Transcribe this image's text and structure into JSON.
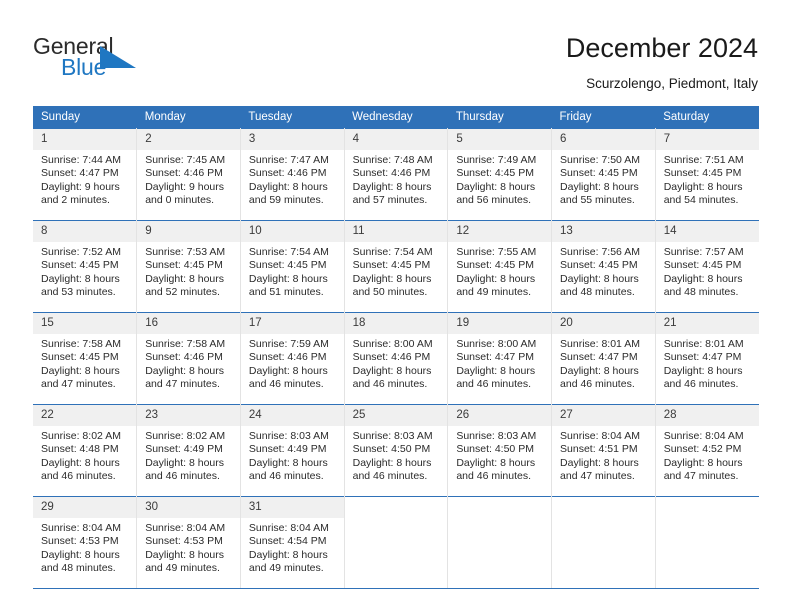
{
  "brand": {
    "name_top": "General",
    "name_bottom": "Blue",
    "accent_color": "#1f77c2"
  },
  "header": {
    "title": "December 2024",
    "subtitle": "Scurzolengo, Piedmont, Italy",
    "header_bg": "#2f71b8"
  },
  "calendar": {
    "weekdays": [
      "Sunday",
      "Monday",
      "Tuesday",
      "Wednesday",
      "Thursday",
      "Friday",
      "Saturday"
    ],
    "weeks": [
      [
        {
          "day": "1",
          "sunrise": "Sunrise: 7:44 AM",
          "sunset": "Sunset: 4:47 PM",
          "daylight_1": "Daylight: 9 hours",
          "daylight_2": "and 2 minutes."
        },
        {
          "day": "2",
          "sunrise": "Sunrise: 7:45 AM",
          "sunset": "Sunset: 4:46 PM",
          "daylight_1": "Daylight: 9 hours",
          "daylight_2": "and 0 minutes."
        },
        {
          "day": "3",
          "sunrise": "Sunrise: 7:47 AM",
          "sunset": "Sunset: 4:46 PM",
          "daylight_1": "Daylight: 8 hours",
          "daylight_2": "and 59 minutes."
        },
        {
          "day": "4",
          "sunrise": "Sunrise: 7:48 AM",
          "sunset": "Sunset: 4:46 PM",
          "daylight_1": "Daylight: 8 hours",
          "daylight_2": "and 57 minutes."
        },
        {
          "day": "5",
          "sunrise": "Sunrise: 7:49 AM",
          "sunset": "Sunset: 4:45 PM",
          "daylight_1": "Daylight: 8 hours",
          "daylight_2": "and 56 minutes."
        },
        {
          "day": "6",
          "sunrise": "Sunrise: 7:50 AM",
          "sunset": "Sunset: 4:45 PM",
          "daylight_1": "Daylight: 8 hours",
          "daylight_2": "and 55 minutes."
        },
        {
          "day": "7",
          "sunrise": "Sunrise: 7:51 AM",
          "sunset": "Sunset: 4:45 PM",
          "daylight_1": "Daylight: 8 hours",
          "daylight_2": "and 54 minutes."
        }
      ],
      [
        {
          "day": "8",
          "sunrise": "Sunrise: 7:52 AM",
          "sunset": "Sunset: 4:45 PM",
          "daylight_1": "Daylight: 8 hours",
          "daylight_2": "and 53 minutes."
        },
        {
          "day": "9",
          "sunrise": "Sunrise: 7:53 AM",
          "sunset": "Sunset: 4:45 PM",
          "daylight_1": "Daylight: 8 hours",
          "daylight_2": "and 52 minutes."
        },
        {
          "day": "10",
          "sunrise": "Sunrise: 7:54 AM",
          "sunset": "Sunset: 4:45 PM",
          "daylight_1": "Daylight: 8 hours",
          "daylight_2": "and 51 minutes."
        },
        {
          "day": "11",
          "sunrise": "Sunrise: 7:54 AM",
          "sunset": "Sunset: 4:45 PM",
          "daylight_1": "Daylight: 8 hours",
          "daylight_2": "and 50 minutes."
        },
        {
          "day": "12",
          "sunrise": "Sunrise: 7:55 AM",
          "sunset": "Sunset: 4:45 PM",
          "daylight_1": "Daylight: 8 hours",
          "daylight_2": "and 49 minutes."
        },
        {
          "day": "13",
          "sunrise": "Sunrise: 7:56 AM",
          "sunset": "Sunset: 4:45 PM",
          "daylight_1": "Daylight: 8 hours",
          "daylight_2": "and 48 minutes."
        },
        {
          "day": "14",
          "sunrise": "Sunrise: 7:57 AM",
          "sunset": "Sunset: 4:45 PM",
          "daylight_1": "Daylight: 8 hours",
          "daylight_2": "and 48 minutes."
        }
      ],
      [
        {
          "day": "15",
          "sunrise": "Sunrise: 7:58 AM",
          "sunset": "Sunset: 4:45 PM",
          "daylight_1": "Daylight: 8 hours",
          "daylight_2": "and 47 minutes."
        },
        {
          "day": "16",
          "sunrise": "Sunrise: 7:58 AM",
          "sunset": "Sunset: 4:46 PM",
          "daylight_1": "Daylight: 8 hours",
          "daylight_2": "and 47 minutes."
        },
        {
          "day": "17",
          "sunrise": "Sunrise: 7:59 AM",
          "sunset": "Sunset: 4:46 PM",
          "daylight_1": "Daylight: 8 hours",
          "daylight_2": "and 46 minutes."
        },
        {
          "day": "18",
          "sunrise": "Sunrise: 8:00 AM",
          "sunset": "Sunset: 4:46 PM",
          "daylight_1": "Daylight: 8 hours",
          "daylight_2": "and 46 minutes."
        },
        {
          "day": "19",
          "sunrise": "Sunrise: 8:00 AM",
          "sunset": "Sunset: 4:47 PM",
          "daylight_1": "Daylight: 8 hours",
          "daylight_2": "and 46 minutes."
        },
        {
          "day": "20",
          "sunrise": "Sunrise: 8:01 AM",
          "sunset": "Sunset: 4:47 PM",
          "daylight_1": "Daylight: 8 hours",
          "daylight_2": "and 46 minutes."
        },
        {
          "day": "21",
          "sunrise": "Sunrise: 8:01 AM",
          "sunset": "Sunset: 4:47 PM",
          "daylight_1": "Daylight: 8 hours",
          "daylight_2": "and 46 minutes."
        }
      ],
      [
        {
          "day": "22",
          "sunrise": "Sunrise: 8:02 AM",
          "sunset": "Sunset: 4:48 PM",
          "daylight_1": "Daylight: 8 hours",
          "daylight_2": "and 46 minutes."
        },
        {
          "day": "23",
          "sunrise": "Sunrise: 8:02 AM",
          "sunset": "Sunset: 4:49 PM",
          "daylight_1": "Daylight: 8 hours",
          "daylight_2": "and 46 minutes."
        },
        {
          "day": "24",
          "sunrise": "Sunrise: 8:03 AM",
          "sunset": "Sunset: 4:49 PM",
          "daylight_1": "Daylight: 8 hours",
          "daylight_2": "and 46 minutes."
        },
        {
          "day": "25",
          "sunrise": "Sunrise: 8:03 AM",
          "sunset": "Sunset: 4:50 PM",
          "daylight_1": "Daylight: 8 hours",
          "daylight_2": "and 46 minutes."
        },
        {
          "day": "26",
          "sunrise": "Sunrise: 8:03 AM",
          "sunset": "Sunset: 4:50 PM",
          "daylight_1": "Daylight: 8 hours",
          "daylight_2": "and 46 minutes."
        },
        {
          "day": "27",
          "sunrise": "Sunrise: 8:04 AM",
          "sunset": "Sunset: 4:51 PM",
          "daylight_1": "Daylight: 8 hours",
          "daylight_2": "and 47 minutes."
        },
        {
          "day": "28",
          "sunrise": "Sunrise: 8:04 AM",
          "sunset": "Sunset: 4:52 PM",
          "daylight_1": "Daylight: 8 hours",
          "daylight_2": "and 47 minutes."
        }
      ],
      [
        {
          "day": "29",
          "sunrise": "Sunrise: 8:04 AM",
          "sunset": "Sunset: 4:53 PM",
          "daylight_1": "Daylight: 8 hours",
          "daylight_2": "and 48 minutes."
        },
        {
          "day": "30",
          "sunrise": "Sunrise: 8:04 AM",
          "sunset": "Sunset: 4:53 PM",
          "daylight_1": "Daylight: 8 hours",
          "daylight_2": "and 49 minutes."
        },
        {
          "day": "31",
          "sunrise": "Sunrise: 8:04 AM",
          "sunset": "Sunset: 4:54 PM",
          "daylight_1": "Daylight: 8 hours",
          "daylight_2": "and 49 minutes."
        },
        {
          "day": "",
          "sunrise": "",
          "sunset": "",
          "daylight_1": "",
          "daylight_2": ""
        },
        {
          "day": "",
          "sunrise": "",
          "sunset": "",
          "daylight_1": "",
          "daylight_2": ""
        },
        {
          "day": "",
          "sunrise": "",
          "sunset": "",
          "daylight_1": "",
          "daylight_2": ""
        },
        {
          "day": "",
          "sunrise": "",
          "sunset": "",
          "daylight_1": "",
          "daylight_2": ""
        }
      ]
    ]
  }
}
